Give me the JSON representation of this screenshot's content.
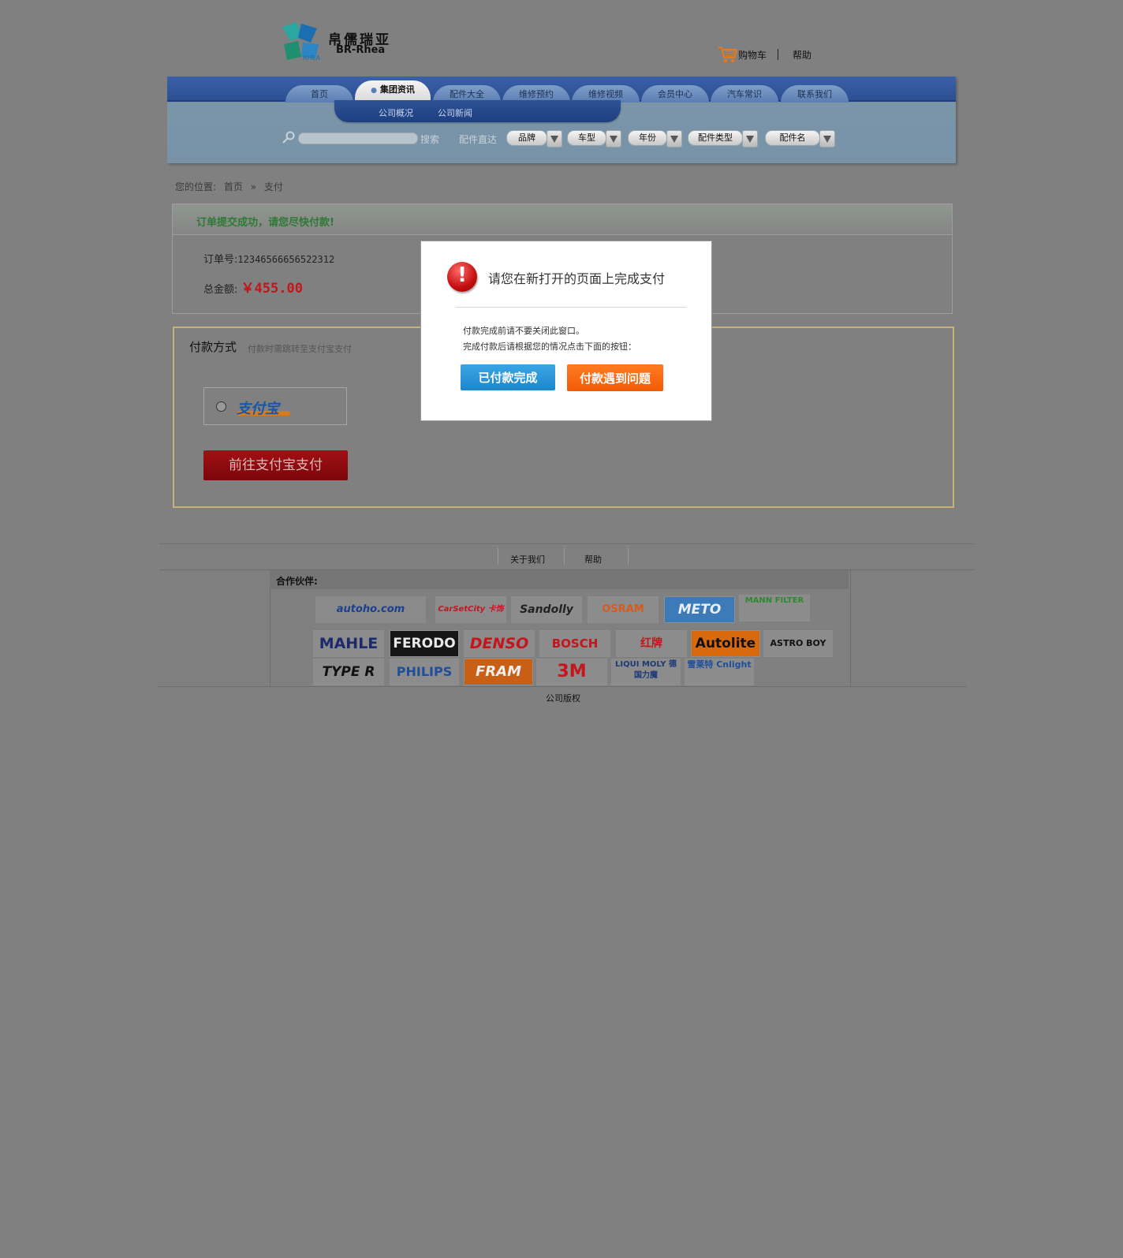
{
  "header": {
    "logo_cn": "帛儒瑞亚",
    "logo_en": "BR-Rhea",
    "cart_label": "购物车",
    "help_label": "帮助"
  },
  "nav": {
    "tabs": [
      "首页",
      "集团资讯",
      "配件大全",
      "维修预约",
      "维修视频",
      "会员中心",
      "汽车常识",
      "联系我们"
    ],
    "active_tab": "集团资讯",
    "subnav": [
      "公司概况",
      "公司新闻"
    ],
    "search_label": "搜索",
    "direct_label": "配件直达",
    "selects": [
      "品牌",
      "车型",
      "年份",
      "配件类型",
      "配件名"
    ]
  },
  "breadcrumb": {
    "prefix": "您的位置:",
    "home": "首页",
    "separator": "»",
    "current": "支付"
  },
  "order": {
    "success_message": "订单提交成功，请您尽快付款!",
    "order_no_label": "订单号:",
    "order_no": "12346566656522312",
    "amount_label": "总金额:",
    "amount": "￥455.00"
  },
  "payment": {
    "title": "付款方式",
    "subtitle": "付款时需跳转至支付宝支付",
    "option_label": "支付宝",
    "go_button": "前往支付宝支付"
  },
  "footer": {
    "links": [
      "关于我们",
      "帮助"
    ],
    "partners_label": "合作伙伴:",
    "partners_row1": [
      "autoho.com",
      "CarSetCity 卡饰社",
      "Sandolly",
      "OSRAM",
      "METO",
      "MANN FILTER"
    ],
    "partners_row2": [
      "MAHLE",
      "FERODO",
      "DENSO",
      "BOSCH",
      "红牌",
      "Autolite",
      "ASTRO BOY"
    ],
    "partners_row3": [
      "TYPE R",
      "PHILIPS",
      "FRAM",
      "3M",
      "LIQUI MOLY 德国力魔",
      "雪莱特 Cnlight"
    ],
    "copyright": "公司版权"
  },
  "modal": {
    "title": "请您在新打开的页面上完成支付",
    "line1": "付款完成前请不要关闭此窗口。",
    "line2": "完成付款后请根据您的情况点击下面的按钮：",
    "done_button": "已付款完成",
    "problem_button": "付款遇到问题"
  }
}
